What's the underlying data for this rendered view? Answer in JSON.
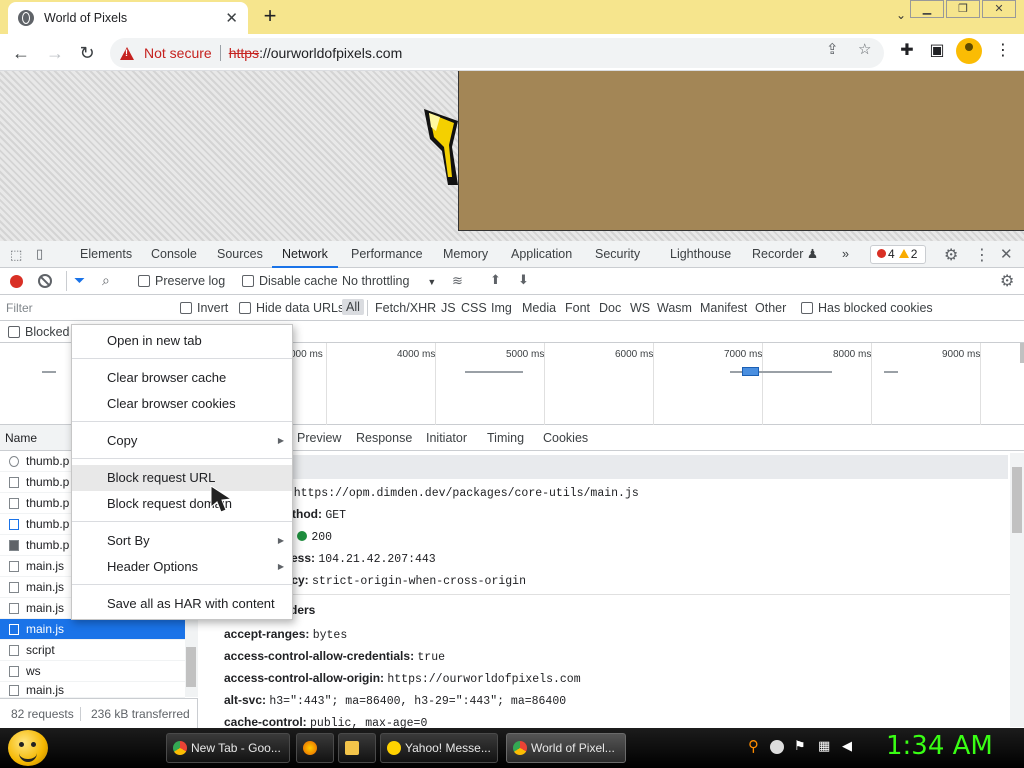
{
  "browser": {
    "tab_title": "World of Pixels",
    "tab_close": "✕",
    "new_tab": "+",
    "omnibox": {
      "security_label": "Not secure",
      "scheme": "https",
      "rest": "://ourworldofpixels.com"
    }
  },
  "devtools": {
    "tabs": [
      "Elements",
      "Console",
      "Sources",
      "Network",
      "Performance",
      "Memory",
      "Application",
      "Security",
      "Lighthouse",
      "Recorder ♟",
      "»"
    ],
    "active_tab": "Network",
    "errors": "4",
    "warnings": "2",
    "network": {
      "preserve_log": "Preserve log",
      "disable_cache": "Disable cache",
      "throttling": "No throttling",
      "filter_placeholder": "Filter",
      "invert": "Invert",
      "hide_data_urls": "Hide data URLs",
      "type_filters": [
        "All",
        "Fetch/XHR",
        "JS",
        "CSS",
        "Img",
        "Media",
        "Font",
        "Doc",
        "WS",
        "Wasm",
        "Manifest",
        "Other"
      ],
      "has_blocked_cookies": "Has blocked cookies",
      "blocked": "Blocked",
      "ticks": [
        "000 ms",
        "4000 ms",
        "5000 ms",
        "6000 ms",
        "7000 ms",
        "8000 ms",
        "9000 ms"
      ],
      "name_header": "Name",
      "rows": [
        "thumb.p",
        "thumb.p",
        "thumb.p",
        "thumb.p",
        "thumb.p",
        "main.js",
        "main.js",
        "main.js",
        "main.js",
        "script",
        "ws",
        "main.js"
      ],
      "selected_row": "main.js",
      "footer_requests": "82 requests",
      "footer_transferred": "236 kB transferred",
      "detail_tabs": [
        "Preview",
        "Response",
        "Initiator",
        "Timing",
        "Cookies"
      ],
      "general": [
        {
          "key": "l:",
          "val": "https://opm.dimden.dev/packages/core-utils/main.js"
        },
        {
          "key": "thod:",
          "val": "GET"
        },
        {
          "key": ":",
          "val": "200"
        },
        {
          "key": "dress:",
          "val": "104.21.42.207:443"
        },
        {
          "key": "icy:",
          "val": "strict-origin-when-cross-origin"
        }
      ],
      "response_headers_title": "ders",
      "response_headers": [
        {
          "key": "accept-ranges:",
          "val": "bytes"
        },
        {
          "key": "access-control-allow-credentials:",
          "val": "true"
        },
        {
          "key": "access-control-allow-origin:",
          "val": "https://ourworldofpixels.com"
        },
        {
          "key": "alt-svc:",
          "val": "h3=\":443\"; ma=86400, h3-29=\":443\"; ma=86400"
        },
        {
          "key": "cache-control:",
          "val": "public, max-age=0"
        }
      ]
    }
  },
  "context_menu": {
    "open_new_tab": "Open in new tab",
    "clear_cache": "Clear browser cache",
    "clear_cookies": "Clear browser cookies",
    "copy": "Copy",
    "block_url": "Block request URL",
    "block_domain": "Block request domain",
    "sort_by": "Sort By",
    "header_options": "Header Options",
    "save_har": "Save all as HAR with content"
  },
  "taskbar": {
    "tasks": [
      "New Tab - Goo...",
      "",
      "",
      "Yahoo! Messe...",
      "World of Pixel..."
    ],
    "clock": "1:34 AM"
  }
}
